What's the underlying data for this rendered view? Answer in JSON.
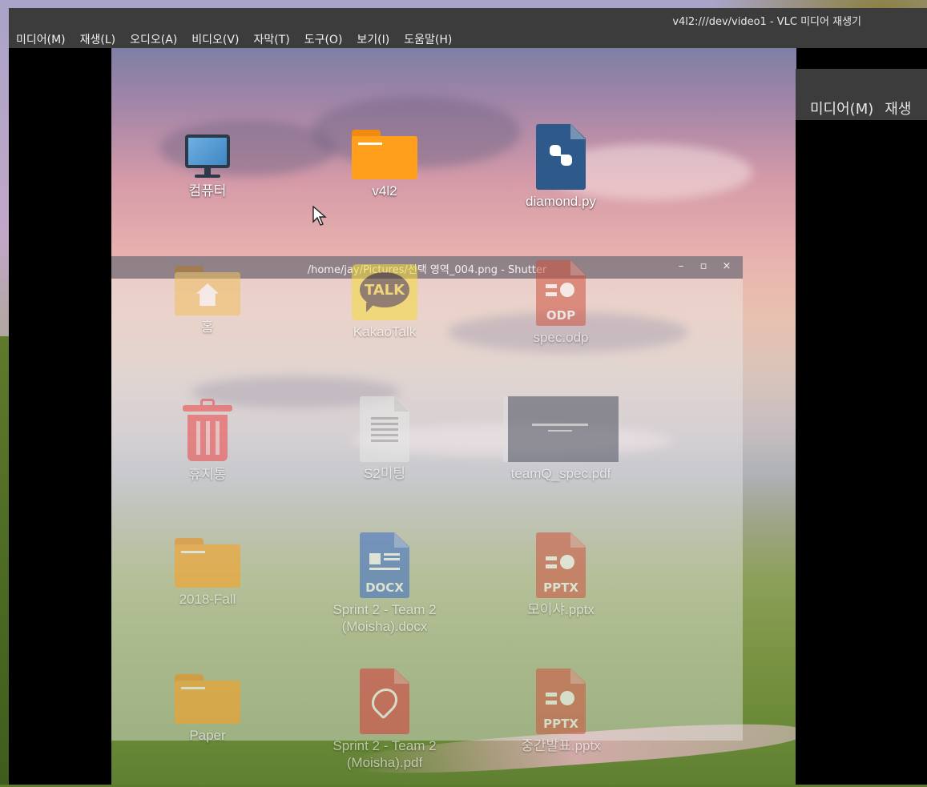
{
  "vlc": {
    "title": "v4l2:///dev/video1 - VLC 미디어 재생기",
    "menu": [
      "미디어(M)",
      "재생(L)",
      "오디오(A)",
      "비디오(V)",
      "자막(T)",
      "도구(O)",
      "보기(I)",
      "도움말(H)"
    ]
  },
  "vlc_second": {
    "menu": [
      "미디어(M)",
      "재생"
    ]
  },
  "shutter": {
    "title": "/home/jay/Pictures/선택 영역_004.png - Shutter",
    "minimize": "–",
    "maximize": "▫",
    "close": "×"
  },
  "desktop_icons": {
    "computer": "컴퓨터",
    "v4l2": "v4l2",
    "diamond": "diamond.py",
    "home": "홈",
    "kakao": "KakaoTalk",
    "kakao_badge": "TALK",
    "spec_odp": "spec.odp",
    "odp_tag": "ODP",
    "trash": "휴지통",
    "s2meeting": "S2미팅",
    "teamq": "teamQ_spec.pdf",
    "fall": "2018-Fall",
    "sprint_docx_1": "Sprint 2 - Team 2",
    "sprint_docx_2": "(Moisha).docx",
    "docx_tag": "DOCX",
    "moisha_pptx": "모이샤.pptx",
    "pptx_tag": "PPTX",
    "paper": "Paper",
    "sprint_pdf_1": "Sprint 2 - Team 2",
    "sprint_pdf_2": "(Moisha).pdf",
    "mid_pptx": "중간발표.pptx",
    "pptx_tag_2": "PPTX"
  },
  "colors": {
    "menubar_bg": "#3c3c3c",
    "folder_orange": "#ff9f1c",
    "python_blue": "#2d5a8a",
    "pptx_red": "#d0533f",
    "docx_blue": "#3a6cc8",
    "pdf_red": "#d63a3a",
    "kakao_yellow": "#f5dc3c"
  }
}
